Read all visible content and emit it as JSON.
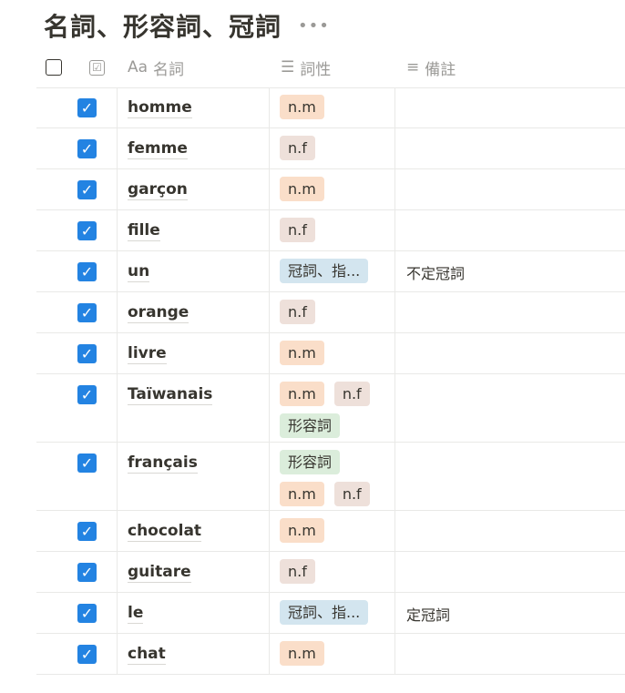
{
  "title": "名詞、形容詞、冠詞",
  "more": "•••",
  "columns": {
    "checkbox_icon": "☑",
    "name_icon": "Aa",
    "name": "名詞",
    "type_icon": "☰",
    "type": "詞性",
    "note_icon": "≡",
    "note": "備註"
  },
  "tag_colors": {
    "n.m": "#fadec9",
    "n.f": "#eee0da",
    "形容詞": "#dbeddb",
    "冠詞、指...": "#d3e5ef"
  },
  "rows": [
    {
      "checked": true,
      "name": "homme",
      "tags": [
        "n.m"
      ],
      "note": ""
    },
    {
      "checked": true,
      "name": "femme",
      "tags": [
        "n.f"
      ],
      "note": ""
    },
    {
      "checked": true,
      "name": "garçon",
      "tags": [
        "n.m"
      ],
      "note": ""
    },
    {
      "checked": true,
      "name": "fille",
      "tags": [
        "n.f"
      ],
      "note": ""
    },
    {
      "checked": true,
      "name": "un",
      "tags": [
        "冠詞、指..."
      ],
      "note": "不定冠詞"
    },
    {
      "checked": true,
      "name": "orange",
      "tags": [
        "n.f"
      ],
      "note": ""
    },
    {
      "checked": true,
      "name": "livre",
      "tags": [
        "n.m"
      ],
      "note": ""
    },
    {
      "checked": true,
      "name": "Taïwanais",
      "tags": [
        "n.m",
        "n.f",
        "形容詞"
      ],
      "note": ""
    },
    {
      "checked": true,
      "name": "français",
      "tags": [
        "形容詞",
        "n.m",
        "n.f"
      ],
      "note": ""
    },
    {
      "checked": true,
      "name": "chocolat",
      "tags": [
        "n.m"
      ],
      "note": ""
    },
    {
      "checked": true,
      "name": "guitare",
      "tags": [
        "n.f"
      ],
      "note": ""
    },
    {
      "checked": true,
      "name": "le",
      "tags": [
        "冠詞、指..."
      ],
      "note": "定冠詞"
    },
    {
      "checked": true,
      "name": "chat",
      "tags": [
        "n.m"
      ],
      "note": ""
    }
  ]
}
